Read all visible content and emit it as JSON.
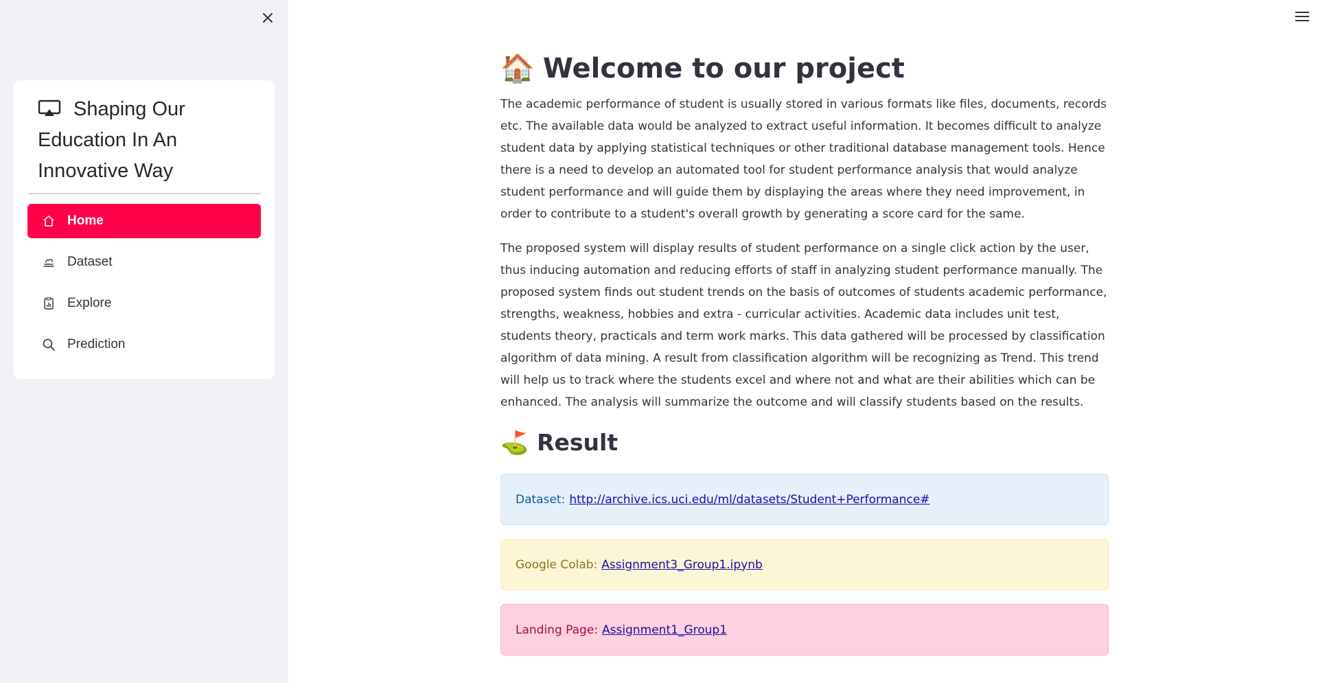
{
  "sidebar": {
    "title": "Shaping Our Education In An Innovative Way",
    "title_icon": "cast-icon",
    "items": [
      {
        "label": "Home",
        "icon": "house-icon",
        "active": true
      },
      {
        "label": "Dataset",
        "icon": "cloud-icon",
        "active": false
      },
      {
        "label": "Explore",
        "icon": "clipboard-data-icon",
        "active": false
      },
      {
        "label": "Prediction",
        "icon": "search-icon",
        "active": false
      }
    ]
  },
  "main": {
    "title_emoji": "🏠",
    "title": "Welcome to our project",
    "paragraphs": [
      "The academic performance of student is usually stored in various formats like files, documents, records etc. The available data would be analyzed to extract useful information. It becomes difficult to analyze student data by applying statistical techniques or other traditional database management tools. Hence there is a need to develop an automated tool for student performance analysis that would analyze student performance and will guide them by displaying the areas where they need improvement, in order to contribute to a student's overall growth by generating a score card for the same.",
      "The proposed system will display results of student performance on a single click action by the user, thus inducing automation and reducing efforts of staff in analyzing student performance manually. The proposed system finds out student trends on the basis of outcomes of students academic performance, strengths, weakness, hobbies and extra - curricular activities. Academic data includes unit test, students theory, practicals and term work marks. This data gathered will be processed by classification algorithm of data mining. A result from classification algorithm will be recognizing as Trend. This trend will help us to track where the students excel and where not and what are their abilities which can be enhanced. The analysis will summarize the outcome and will classify students based on the results."
    ],
    "result_emoji": "⛳",
    "result_heading": "Result",
    "alerts": [
      {
        "label": "Dataset:",
        "link": "http://archive.ics.uci.edu/ml/datasets/Student+Performance#"
      },
      {
        "label": "Google Colab:",
        "link": "Assignment3_Group1.ipynb"
      },
      {
        "label": "Landing Page:",
        "link": "Assignment1_Group1"
      }
    ]
  },
  "colors": {
    "accent": "#ff0049",
    "sidebar_bg": "#f0f2f6",
    "info_bg": "#e5f0fb",
    "warn_bg": "#fdf6d6",
    "error_bg": "#ffd0dd"
  }
}
